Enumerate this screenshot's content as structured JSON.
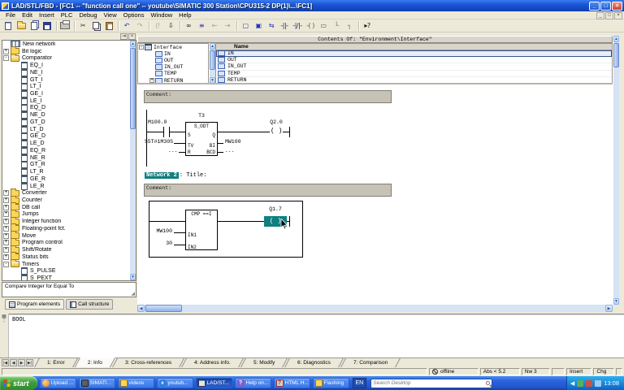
{
  "window": {
    "title": "LAD/STL/FBD  -  [FC1 -- \"function call one\" -- youtube\\SIMATIC 300 Station\\CPU315-2 DP(1)\\...\\FC1]",
    "controls": {
      "minimize": "_",
      "maximize": "□",
      "close": "×"
    }
  },
  "menu": {
    "items": [
      "File",
      "Edit",
      "Insert",
      "PLC",
      "Debug",
      "View",
      "Options",
      "Window",
      "Help"
    ],
    "mdi": {
      "minimize": "_",
      "restore": "□",
      "close": "×"
    }
  },
  "toolbar": {
    "buttons": [
      {
        "name": "new-button",
        "icon": "page"
      },
      {
        "name": "open-button",
        "icon": "folderopen"
      },
      {
        "name": "open-online-button",
        "icon": "pages"
      },
      {
        "name": "save-button",
        "icon": "disk"
      },
      {
        "type": "sep"
      },
      {
        "name": "print-button",
        "icon": "printer"
      },
      {
        "type": "sep"
      },
      {
        "name": "cut-button",
        "glyph": "✂"
      },
      {
        "name": "copy-button",
        "icon": "copy"
      },
      {
        "name": "paste-button",
        "icon": "paste"
      },
      {
        "type": "sep"
      },
      {
        "name": "undo-button",
        "glyph": "↶",
        "color": "#2233bb"
      },
      {
        "name": "redo-button",
        "glyph": "↷",
        "disabled": true
      },
      {
        "type": "sep"
      },
      {
        "name": "go-online-button",
        "glyph": "(!",
        "disabled": true
      },
      {
        "name": "download-button",
        "glyph": "⇩",
        "color": "#111111"
      },
      {
        "type": "sep"
      },
      {
        "name": "monitor-onoff-button",
        "glyph": "∞",
        "color": "#111111"
      },
      {
        "name": "symbol-info-button",
        "glyph": "≡",
        "color": "#2233bb"
      },
      {
        "name": "prev-error-button",
        "glyph": "⇤",
        "disabled": true
      },
      {
        "name": "next-error-button",
        "glyph": "⇥",
        "disabled": true
      },
      {
        "type": "sep"
      },
      {
        "name": "overview-window-button",
        "glyph": "▢",
        "color": "#2233bb"
      },
      {
        "name": "detail-window-button",
        "glyph": "▣",
        "color": "#2233bb"
      },
      {
        "name": "split-view-button",
        "glyph": "⇆",
        "color": "#2233bb"
      },
      {
        "name": "insert-no-contact-button",
        "glyph": "-||-",
        "color": "#17175e"
      },
      {
        "name": "insert-nc-contact-button",
        "glyph": "-|/|-",
        "color": "#17175e"
      },
      {
        "name": "insert-coil-button",
        "glyph": "-( )",
        "color": "#555533"
      },
      {
        "name": "insert-box-button",
        "glyph": "▭",
        "color": "#555533"
      },
      {
        "name": "open-branch-button",
        "glyph": "┗",
        "disabled": true
      },
      {
        "name": "close-branch-button",
        "glyph": "┓",
        "disabled": true
      },
      {
        "type": "sep"
      },
      {
        "name": "help-cursor-button",
        "glyph": "▸?",
        "color": "#111111"
      }
    ]
  },
  "catalog": {
    "panel_buttons": {
      "dock": "⇥",
      "close": "×"
    },
    "items": [
      {
        "label": "New network",
        "icon": "network",
        "level": 0
      },
      {
        "label": "Bit logic",
        "icon": "folder",
        "level": 0,
        "expander": "+"
      },
      {
        "label": "Comparator",
        "icon": "folderopen",
        "level": 0,
        "expander": "-"
      },
      {
        "label": "EQ_I",
        "icon": "block",
        "level": 1
      },
      {
        "label": "NE_I",
        "icon": "block",
        "level": 1
      },
      {
        "label": "GT_I",
        "icon": "block",
        "level": 1
      },
      {
        "label": "LT_I",
        "icon": "block",
        "level": 1
      },
      {
        "label": "GE_I",
        "icon": "block",
        "level": 1
      },
      {
        "label": "LE_I",
        "icon": "block",
        "level": 1
      },
      {
        "label": "EQ_D",
        "icon": "block",
        "level": 1
      },
      {
        "label": "NE_D",
        "icon": "block",
        "level": 1
      },
      {
        "label": "GT_D",
        "icon": "block",
        "level": 1
      },
      {
        "label": "LT_D",
        "icon": "block",
        "level": 1
      },
      {
        "label": "GE_D",
        "icon": "block",
        "level": 1
      },
      {
        "label": "LE_D",
        "icon": "block",
        "level": 1
      },
      {
        "label": "EQ_R",
        "icon": "block",
        "level": 1
      },
      {
        "label": "NE_R",
        "icon": "block",
        "level": 1
      },
      {
        "label": "GT_R",
        "icon": "block",
        "level": 1
      },
      {
        "label": "LT_R",
        "icon": "block",
        "level": 1
      },
      {
        "label": "GE_R",
        "icon": "block",
        "level": 1
      },
      {
        "label": "LE_R",
        "icon": "block",
        "level": 1
      },
      {
        "label": "Converter",
        "icon": "folder",
        "level": 0,
        "expander": "+"
      },
      {
        "label": "Counter",
        "icon": "folder",
        "level": 0,
        "expander": "+"
      },
      {
        "label": "DB call",
        "icon": "folder",
        "level": 0,
        "expander": "+"
      },
      {
        "label": "Jumps",
        "icon": "folder",
        "level": 0,
        "expander": "+"
      },
      {
        "label": "Integer function",
        "icon": "folder",
        "level": 0,
        "expander": "+"
      },
      {
        "label": "Floating-point fct.",
        "icon": "folder",
        "level": 0,
        "expander": "+"
      },
      {
        "label": "Move",
        "icon": "folder",
        "level": 0,
        "expander": "+"
      },
      {
        "label": "Program control",
        "icon": "folder",
        "level": 0,
        "expander": "+"
      },
      {
        "label": "Shift/Rotate",
        "icon": "folder",
        "level": 0,
        "expander": "+"
      },
      {
        "label": "Status bits",
        "icon": "folder",
        "level": 0,
        "expander": "+"
      },
      {
        "label": "Timers",
        "icon": "folderopen",
        "level": 0,
        "expander": "-"
      },
      {
        "label": "S_PULSE",
        "icon": "block",
        "level": 1
      },
      {
        "label": "S_PEXT",
        "icon": "block",
        "level": 1
      }
    ],
    "description": "Compare Integer for Equal To",
    "tabs": [
      {
        "label": "Program elements",
        "icon": "program",
        "active": true,
        "name": "tab-program-elements"
      },
      {
        "label": "Call structure",
        "icon": "callstruct",
        "name": "tab-call-structure"
      }
    ]
  },
  "interface_pane": {
    "header": "Contents Of:  \"Environment\\Interface\"",
    "tree": [
      {
        "label": "Interface",
        "icon": "interface",
        "level": 0,
        "expander": "-"
      },
      {
        "label": "IN",
        "icon": "decl",
        "level": 1
      },
      {
        "label": "OUT",
        "icon": "decl",
        "level": 1
      },
      {
        "label": "IN_OUT",
        "icon": "decl",
        "level": 1
      },
      {
        "label": "TEMP",
        "icon": "decl",
        "level": 1
      },
      {
        "label": "RETURN",
        "icon": "decl",
        "level": 1,
        "expander": "+"
      }
    ],
    "table": {
      "header": "Name",
      "rows": [
        {
          "label": "IN",
          "icon": "decl",
          "selected": true
        },
        {
          "label": "OUT",
          "icon": "decl"
        },
        {
          "label": "IN_OUT",
          "icon": "decl"
        },
        {
          "label": "TEMP",
          "icon": "decl"
        },
        {
          "label": "RETURN",
          "icon": "decl"
        }
      ]
    }
  },
  "editor": {
    "network1": {
      "comment": "Comment:",
      "contact_label": "M100.0",
      "timer_name": "T3",
      "timer_type": "S_ODT",
      "pin_s": "S",
      "pin_q": "Q",
      "pin_tv": "TV",
      "pin_bi": "BI",
      "pin_r": "R",
      "pin_bcd": "BCD",
      "tv_value": "S5T#1M30S",
      "r_value": "...",
      "bi_value": "MW100",
      "bcd_value": "...",
      "coil_symbol": "( )",
      "coil_label": "Q2.0"
    },
    "network2": {
      "label": "Network 2",
      "title": ": Title:",
      "comment": "Comment:",
      "block_title": "CMP ==I",
      "pin_in1": "IN1",
      "pin_in2": "IN2",
      "in1_value": "MW100",
      "in2_value": "30",
      "coil_symbol": "( )",
      "coil_label": "Q1.7"
    }
  },
  "info_panel": {
    "text": "BOOL"
  },
  "bottom_tabs": [
    {
      "label": "1: Error",
      "name": "tab-error"
    },
    {
      "label": "2: Info",
      "active": true,
      "name": "tab-info"
    },
    {
      "label": "3: Cross-references",
      "name": "tab-cross-references"
    },
    {
      "label": "4: Address info.",
      "name": "tab-address-info"
    },
    {
      "label": "5: Modify",
      "name": "tab-modify"
    },
    {
      "label": "6: Diagnostics",
      "name": "tab-diagnostics"
    },
    {
      "label": "7: Comparison",
      "name": "tab-comparison"
    }
  ],
  "nav_buttons": [
    {
      "glyph": "|◀",
      "name": "first-tab-button"
    },
    {
      "glyph": "◀",
      "name": "prev-tab-button"
    },
    {
      "glyph": "▶",
      "name": "next-tab-button"
    },
    {
      "glyph": "▶|",
      "name": "last-tab-button"
    }
  ],
  "status_bar": {
    "connection": "offline",
    "abs": "Abs < 5.2",
    "network": "Nw 3",
    "insert": "Insert",
    "chg": "Chg"
  },
  "taskbar": {
    "start_label": "start",
    "tasks": [
      {
        "label": "Upload ...",
        "icon": "firefox",
        "name": "task-upload"
      },
      {
        "label": "SIMATI...",
        "icon": "simatic",
        "name": "task-simatic"
      },
      {
        "label": "videos",
        "icon": "tfolder",
        "name": "task-videos"
      },
      {
        "label": "youtub...",
        "icon": "ie",
        "name": "task-youtube"
      },
      {
        "label": "LAD/ST...",
        "icon": "ladstl",
        "active": true,
        "name": "task-ladstl"
      },
      {
        "label": "Help on...",
        "icon": "helpapp",
        "name": "task-help"
      },
      {
        "label": "HTML H...",
        "icon": "htmlhelp",
        "name": "task-htmlhelp"
      },
      {
        "label": "Flashing",
        "icon": "tfolder",
        "name": "task-flashing"
      }
    ],
    "language": "EN",
    "search_placeholder": "Search Desktop",
    "time": "13:08"
  }
}
